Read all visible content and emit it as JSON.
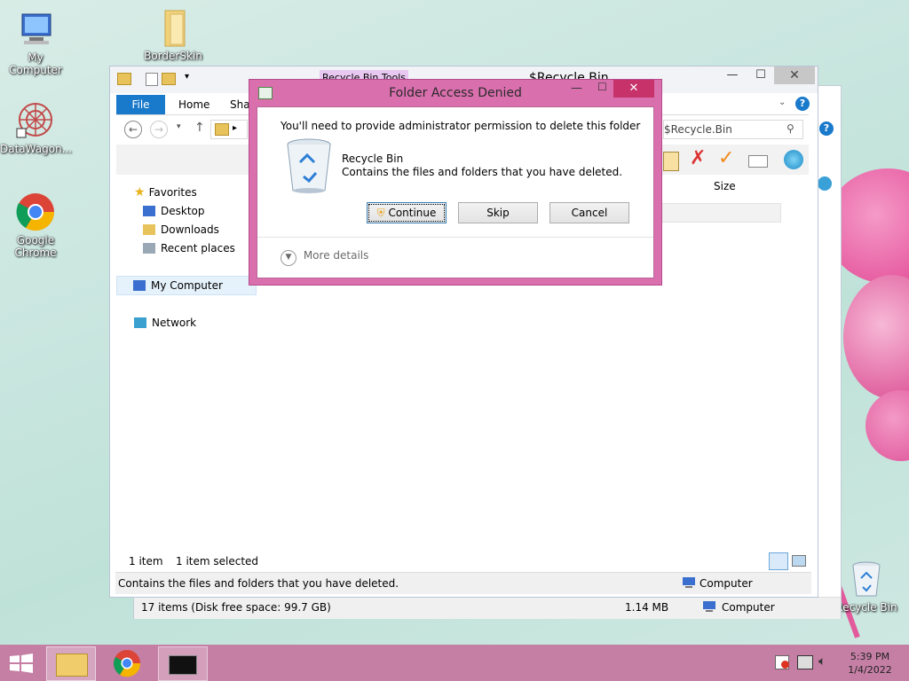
{
  "desktop": {
    "icons": [
      {
        "label": "My Computer",
        "icon": "computer-icon"
      },
      {
        "label": "BorderSkin",
        "icon": "folder-icon"
      },
      {
        "label": "DataWagon...",
        "icon": "datawagon-icon"
      },
      {
        "label": "Google Chrome",
        "icon": "chrome-icon"
      },
      {
        "label": "Recycle Bin",
        "icon": "recycle-bin-icon"
      }
    ]
  },
  "explorer": {
    "title": "$Recycle.Bin",
    "context_tab": "Recycle Bin Tools",
    "ribbon_tabs": [
      "File",
      "Home",
      "Shar"
    ],
    "address_partial": "▸",
    "search_placeholder": "Search $Recycle.Bin",
    "search_value": "$Recycle.Bin",
    "column_size": "Size",
    "nav": {
      "favorites": "Favorites",
      "desktop": "Desktop",
      "downloads": "Downloads",
      "recent": "Recent places",
      "my_computer": "My Computer",
      "network": "Network"
    },
    "status_items": "1 item",
    "status_selected": "1 item selected",
    "statusbar_desc": "Contains the files and folders that you have deleted.",
    "statusbar_location": "Computer"
  },
  "back_window": {
    "status_text": "17 items (Disk free space: 99.7 GB)",
    "status_size": "1.14 MB",
    "status_location": "Computer"
  },
  "dialog": {
    "title": "Folder Access Denied",
    "message": "You'll need to provide administrator permission to delete this folder",
    "item_name": "Recycle Bin",
    "item_desc": "Contains the files and folders that you have deleted.",
    "btn_continue": "Continue",
    "btn_skip": "Skip",
    "btn_cancel": "Cancel",
    "more_details": "More details"
  },
  "taskbar": {
    "time": "5:39 PM",
    "date": "1/4/2022"
  },
  "colors": {
    "dialog_frame": "#da6fae",
    "taskbar": "#c57fa5",
    "accent": "#1979ca"
  }
}
